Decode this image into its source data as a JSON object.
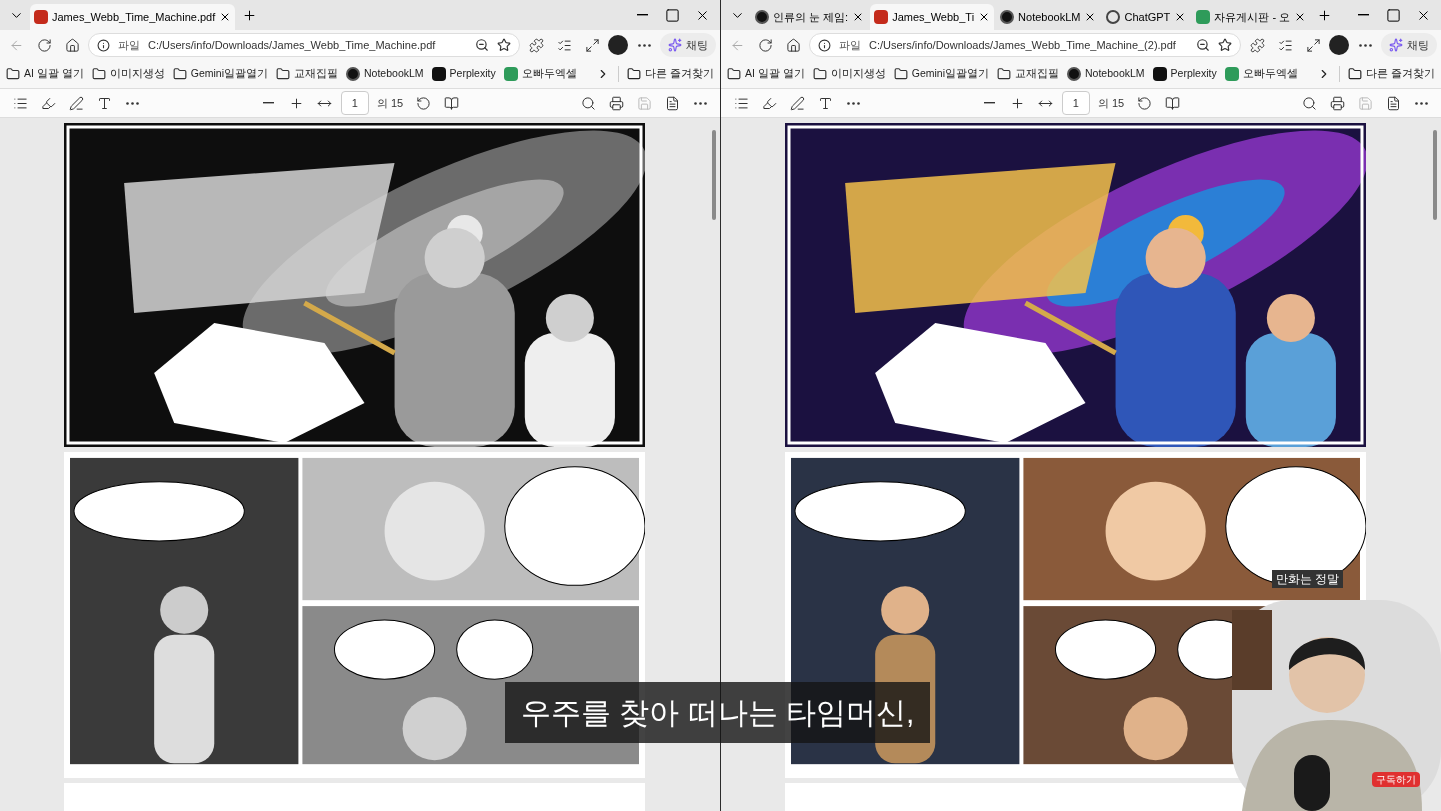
{
  "windows": [
    {
      "tabs": [
        {
          "title": "James_Webb_Time_Machine.pdf",
          "selected": true,
          "kind": "pdf"
        }
      ],
      "address": {
        "scheme": "파일",
        "url": "C:/Users/info/Downloads/James_Webb_Time_Machine.pdf"
      },
      "copilot": "채팅",
      "bookmarks": [
        {
          "label": "AI 일괄 열기",
          "kind": "folder"
        },
        {
          "label": "이미지생성",
          "kind": "folder"
        },
        {
          "label": "Gemini일괄열기",
          "kind": "folder"
        },
        {
          "label": "교재집필",
          "kind": "folder"
        },
        {
          "label": "NotebookLM",
          "kind": "notebook"
        },
        {
          "label": "Perplexity",
          "kind": "perplexity"
        },
        {
          "label": "오빠두엑셀",
          "kind": "sheet"
        }
      ],
      "other_bookmarks": "다른 즐겨찾기",
      "pdf_toolbar": {
        "page": "1",
        "total": "의 15"
      }
    },
    {
      "tabs": [
        {
          "title": "인류의 눈 제임:",
          "selected": false,
          "kind": "notebook"
        },
        {
          "title": "James_Webb_Ti",
          "selected": true,
          "kind": "pdf"
        },
        {
          "title": "NotebookLM",
          "selected": false,
          "kind": "notebook"
        },
        {
          "title": "ChatGPT",
          "selected": false,
          "kind": "chatgpt"
        },
        {
          "title": "자유게시판 - 오",
          "selected": false,
          "kind": "sheet"
        }
      ],
      "address": {
        "scheme": "파일",
        "url": "C:/Users/info/Downloads/James_Webb_Time_Machine_(2).pdf"
      },
      "copilot": "채팅",
      "bookmarks": [
        {
          "label": "AI 일괄 열기",
          "kind": "folder"
        },
        {
          "label": "이미지생성",
          "kind": "folder"
        },
        {
          "label": "Gemini일괄열기",
          "kind": "folder"
        },
        {
          "label": "교재집필",
          "kind": "folder"
        },
        {
          "label": "NotebookLM",
          "kind": "notebook"
        },
        {
          "label": "Perplexity",
          "kind": "perplexity"
        },
        {
          "label": "오빠두엑셀",
          "kind": "sheet"
        }
      ],
      "other_bookmarks": "다른 즐겨찾기",
      "pdf_toolbar": {
        "page": "1",
        "total": "의 15"
      }
    }
  ],
  "overlay": {
    "subtitle": "우주를 찾아 떠나는 타임머신,",
    "chat_text": "만화는 정말",
    "subscribe": "구독하기"
  }
}
